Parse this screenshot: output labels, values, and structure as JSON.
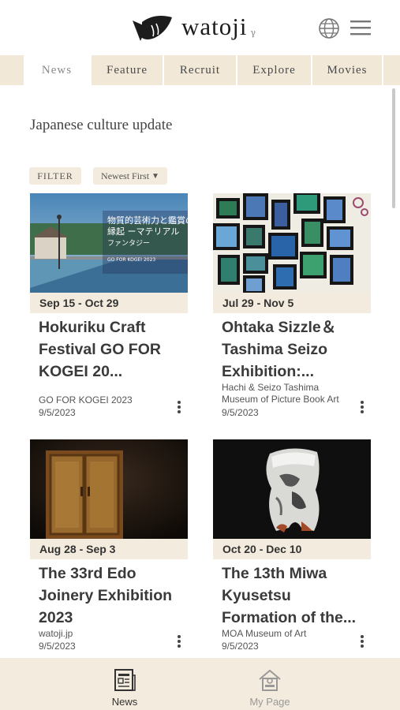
{
  "header": {
    "logo_text": "watoji",
    "logo_sup": "γ",
    "globe_icon": "globe-icon",
    "menu_icon": "hamburger-menu-icon"
  },
  "tabs": [
    {
      "label": "News",
      "active": true
    },
    {
      "label": "Feature",
      "active": false
    },
    {
      "label": "Recruit",
      "active": false
    },
    {
      "label": "Explore",
      "active": false
    },
    {
      "label": "Movies",
      "active": false
    }
  ],
  "section_title": "Japanese culture update",
  "filter_label": "FILTER",
  "sort_label": "Newest First",
  "cards": [
    {
      "date_range": "Sep 15 - Oct 29",
      "title": "Hokuriku Craft Festival GO FOR KOGEI 20...",
      "source": "GO FOR KOGEI 2023",
      "published": "9/5/2023"
    },
    {
      "date_range": "Jul 29 - Nov 5",
      "title": "Ohtaka Sizzle＆ Tashima Seizo Exhibition:...",
      "source": "Hachi & Seizo Tashima Museum of Picture Book Art",
      "published": "9/5/2023"
    },
    {
      "date_range": "Aug 28 - Sep 3",
      "title": "The 33rd Edo Joinery Exhibition 2023",
      "source": "watoji.jp",
      "published": "9/5/2023"
    },
    {
      "date_range": "Oct 20 - Dec 10",
      "title": "The 13th Miwa Kyusetsu Formation of the...",
      "source": "MOA Museum of Art",
      "published": "9/5/2023"
    }
  ],
  "card_poster_text": [
    "ファンタジー",
    "GO FOR KOGEI 2023"
  ],
  "bottom_nav": {
    "news_label": "News",
    "mypage_label": "My Page"
  },
  "colors": {
    "beige": "#f3ebdd",
    "text": "#3a3a3a"
  }
}
